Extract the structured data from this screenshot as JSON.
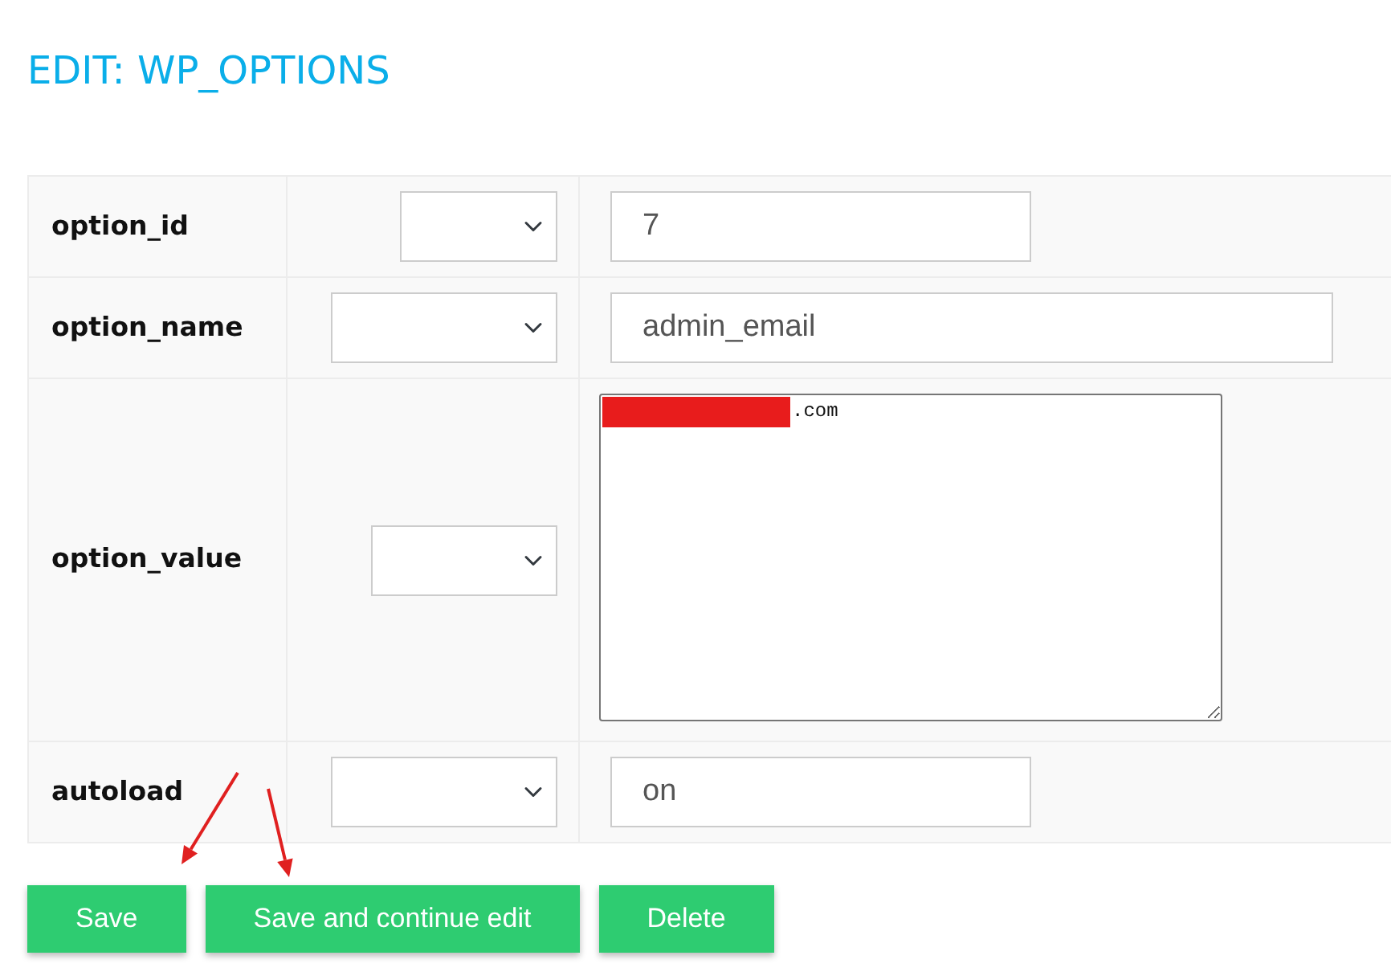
{
  "title": "EDIT: WP_OPTIONS",
  "fields": [
    {
      "label": "option_id",
      "dropdown": true,
      "kind": "input",
      "value": "7",
      "redacted": false
    },
    {
      "label": "option_name",
      "dropdown": true,
      "kind": "input",
      "value": "admin_email",
      "redacted": false
    },
    {
      "label": "option_value",
      "dropdown": true,
      "kind": "textarea",
      "value": ".com",
      "redacted": true
    },
    {
      "label": "autoload",
      "dropdown": true,
      "kind": "input",
      "value": "on",
      "redacted": false
    }
  ],
  "buttons": [
    {
      "label": "Save"
    },
    {
      "label": "Save and continue edit"
    },
    {
      "label": "Delete"
    }
  ],
  "annotations": [
    {
      "kind": "arrow"
    },
    {
      "kind": "arrow"
    }
  ]
}
